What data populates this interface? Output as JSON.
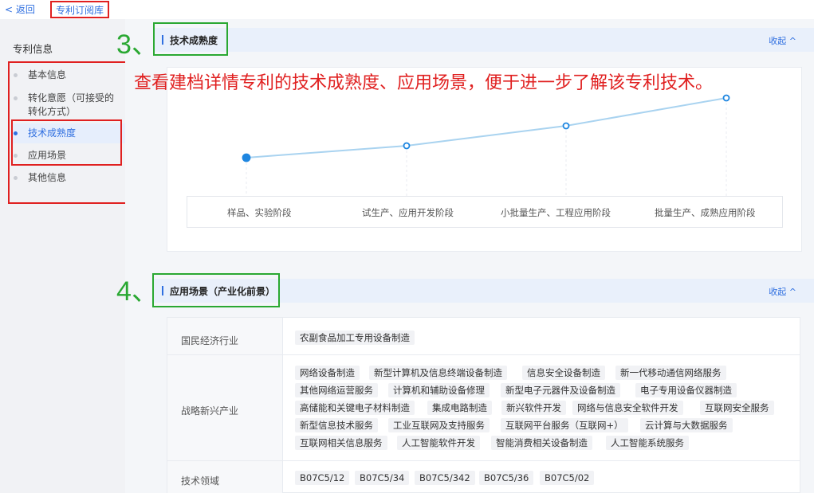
{
  "header": {
    "back_label": "< 返回",
    "breadcrumb": "专利订阅库"
  },
  "sidebar": {
    "title": "专利信息",
    "items": [
      {
        "label": "基本信息"
      },
      {
        "label": "转化意愿（可接受的",
        "label2": "转化方式）"
      },
      {
        "label": "技术成熟度",
        "active": true
      },
      {
        "label": "应用场景"
      },
      {
        "label": "其他信息"
      }
    ]
  },
  "annotation": "查看建档详情专利的技术成熟度、应用场景，便于进一步了解该专利技术。",
  "step3": {
    "number": "3、",
    "title": "技术成熟度",
    "collapse": "收起 ^"
  },
  "step4": {
    "number": "4、",
    "title": "应用场景（产业化前景）",
    "collapse": "收起 ^"
  },
  "maturity": {
    "stages": [
      "样品、实验阶段",
      "试生产、应用开发阶段",
      "小批量生产、工程应用阶段",
      "批量生产、成熟应用阶段"
    ],
    "current_stage_index": 0,
    "line_color": "#a9d3f0",
    "point_color": "#1e86e0"
  },
  "scenario": {
    "rows": [
      {
        "label": "国民经济行业",
        "tags": [
          "农副食品加工专用设备制造"
        ]
      },
      {
        "label": "战略新兴产业",
        "tags": [
          [
            "网络设备制造",
            "新型计算机及信息终端设备制造",
            "信息安全设备制造",
            "新一代移动通信网络服务"
          ],
          [
            "其他网络运营服务",
            "计算机和辅助设备修理",
            "新型电子元器件及设备制造",
            "电子专用设备仪器制造"
          ],
          [
            "高储能和关键电子材料制造",
            "集成电路制造",
            "新兴软件开发",
            "网络与信息安全软件开发",
            "互联网安全服务"
          ],
          [
            "新型信息技术服务",
            "工业互联网及支持服务",
            "互联网平台服务（互联网+）",
            "云计算与大数据服务"
          ],
          [
            "互联网相关信息服务",
            "人工智能软件开发",
            "智能消费相关设备制造",
            "人工智能系统服务"
          ]
        ]
      },
      {
        "label": "技术领域",
        "tags": [
          "B07C5/12",
          "B07C5/34",
          "B07C5/342",
          "B07C5/36",
          "B07C5/02"
        ]
      }
    ]
  }
}
